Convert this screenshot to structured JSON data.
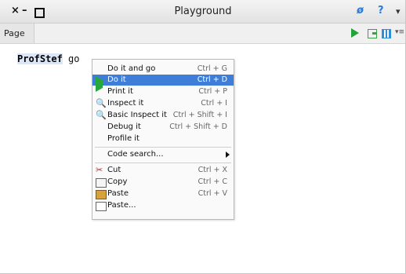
{
  "window": {
    "title": "Playground",
    "controls": {
      "close": "×",
      "minimize": "–"
    }
  },
  "titlebar_right": {
    "phi": "ø",
    "help": "?",
    "menu": "▾"
  },
  "tabs": [
    {
      "label": "Page"
    }
  ],
  "toolbar": {
    "more": "▾≡"
  },
  "editor": {
    "code_class": "ProfStef",
    "code_message": " go"
  },
  "context_menu": {
    "items": [
      {
        "label": "Do it and go",
        "shortcut": "Ctrl + G",
        "icon": ""
      },
      {
        "label": "Do it",
        "shortcut": "Ctrl + D",
        "icon": "play-icon",
        "selected": true
      },
      {
        "label": "Print it",
        "shortcut": "Ctrl + P",
        "icon": ""
      },
      {
        "label": "Inspect it",
        "shortcut": "Ctrl + I",
        "icon": "inspect-icon"
      },
      {
        "label": "Basic Inspect it",
        "shortcut": "Ctrl + Shift + I",
        "icon": "inspect-icon"
      },
      {
        "label": "Debug it",
        "shortcut": "Ctrl + Shift + D",
        "icon": ""
      },
      {
        "label": "Profile it",
        "shortcut": "",
        "icon": ""
      },
      {
        "label": "Code search...",
        "shortcut": "",
        "icon": "",
        "submenu": true
      },
      {
        "label": "Cut",
        "shortcut": "Ctrl + X",
        "icon": "scissors-icon"
      },
      {
        "label": "Copy",
        "shortcut": "Ctrl + C",
        "icon": "copy-icon"
      },
      {
        "label": "Paste",
        "shortcut": "Ctrl + V",
        "icon": "paste-icon"
      },
      {
        "label": "Paste...",
        "shortcut": "",
        "icon": "paste-dots-icon"
      }
    ],
    "selected_color": "#3f7ed8"
  }
}
